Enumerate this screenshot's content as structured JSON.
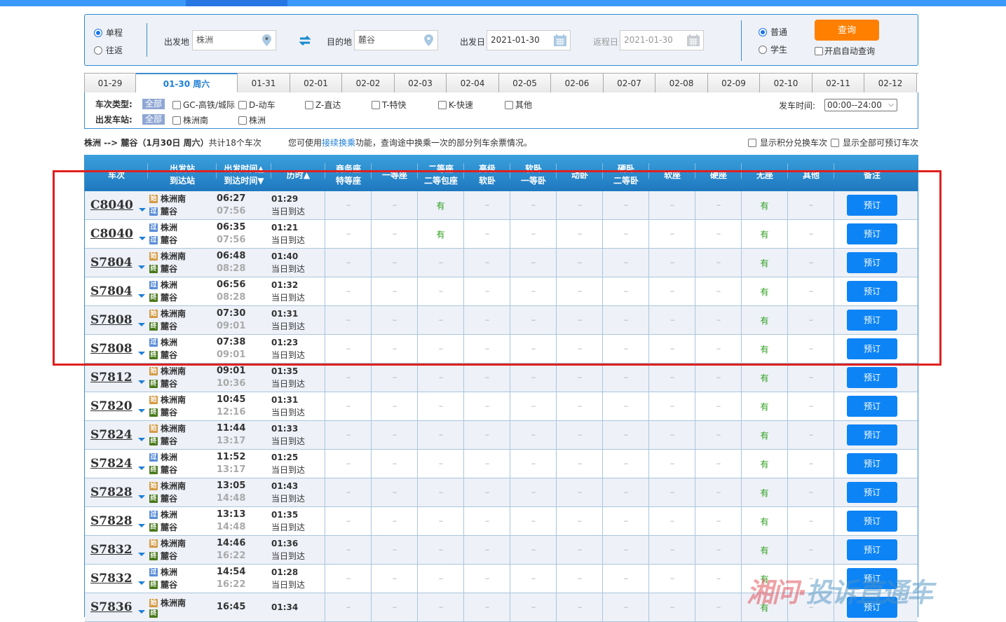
{
  "search": {
    "trip_types": [
      {
        "label": "单程",
        "selected": true
      },
      {
        "label": "往返",
        "selected": false
      }
    ],
    "from_label": "出发地",
    "from_value": "株洲",
    "to_label": "目的地",
    "to_value": "麓谷",
    "depart_label": "出发日",
    "depart_value": "2021-01-30",
    "return_label": "返程日",
    "return_value": "2021-01-30",
    "passenger_types": [
      {
        "label": "普通",
        "selected": true
      },
      {
        "label": "学生",
        "selected": false
      }
    ],
    "query_label": "查询",
    "auto_query_label": "开启自动查询"
  },
  "date_tabs": [
    {
      "label": "01-29",
      "active": false
    },
    {
      "label": "01-30 周六",
      "active": true
    },
    {
      "label": "01-31",
      "active": false
    },
    {
      "label": "02-01",
      "active": false
    },
    {
      "label": "02-02",
      "active": false
    },
    {
      "label": "02-03",
      "active": false
    },
    {
      "label": "02-04",
      "active": false
    },
    {
      "label": "02-05",
      "active": false
    },
    {
      "label": "02-06",
      "active": false
    },
    {
      "label": "02-07",
      "active": false
    },
    {
      "label": "02-08",
      "active": false
    },
    {
      "label": "02-09",
      "active": false
    },
    {
      "label": "02-10",
      "active": false
    },
    {
      "label": "02-11",
      "active": false
    },
    {
      "label": "02-12",
      "active": false
    }
  ],
  "filters": {
    "train_type_label": "车次类型:",
    "all_label": "全部",
    "train_types": [
      "GC-高铁/城际",
      "D-动车",
      "Z-直达",
      "T-特快",
      "K-快速",
      "其他"
    ],
    "station_label": "出发车站:",
    "stations": [
      "株洲南",
      "株洲"
    ],
    "depart_time_label": "发车时间:",
    "depart_time_value": "00:00--24:00"
  },
  "summary": {
    "route": "株洲 --> 麓谷（1月30日  周六）",
    "count": "共计18个车次",
    "hint_prefix": "您可使用",
    "hint_link": "接续换乘",
    "hint_suffix": "功能，查询途中换乘一次的部分列车余票情况。",
    "option_points": "显示积分兑换车次",
    "option_all": "显示全部可预订车次"
  },
  "table": {
    "headers": [
      [
        "车次"
      ],
      [
        "出发站",
        "到达站"
      ],
      [
        "出发时间▲",
        "到达时间▼"
      ],
      [
        "历时▲"
      ],
      [
        "商务座",
        "特等座"
      ],
      [
        "一等座"
      ],
      [
        "二等座",
        "二等包座"
      ],
      [
        "高级",
        "软卧"
      ],
      [
        "软卧",
        "一等卧"
      ],
      [
        "动卧"
      ],
      [
        "硬卧",
        "二等卧"
      ],
      [
        "软座"
      ],
      [
        "硬座"
      ],
      [
        "无座"
      ],
      [
        "其他"
      ],
      [
        "备注"
      ]
    ],
    "badge_labels": {
      "start": "始",
      "pass": "过",
      "end": "终"
    },
    "na": "--",
    "yes": "有",
    "book_label": "预订",
    "rows": [
      {
        "train": "C8040",
        "from": "株洲南",
        "from_type": "start",
        "to": "麓谷",
        "to_type": "pass",
        "dep": "06:27",
        "arr": "07:56",
        "duration": "01:29",
        "arrive_note": "当日到达",
        "seats": [
          "--",
          "--",
          "有",
          "--",
          "--",
          "--",
          "--",
          "--",
          "--",
          "有",
          "--"
        ]
      },
      {
        "train": "C8040",
        "from": "株洲",
        "from_type": "pass",
        "to": "麓谷",
        "to_type": "pass",
        "dep": "06:35",
        "arr": "07:56",
        "duration": "01:21",
        "arrive_note": "当日到达",
        "seats": [
          "--",
          "--",
          "有",
          "--",
          "--",
          "--",
          "--",
          "--",
          "--",
          "有",
          "--"
        ]
      },
      {
        "train": "S7804",
        "from": "株洲南",
        "from_type": "start",
        "to": "麓谷",
        "to_type": "end",
        "dep": "06:48",
        "arr": "08:28",
        "duration": "01:40",
        "arrive_note": "当日到达",
        "seats": [
          "--",
          "--",
          "--",
          "--",
          "--",
          "--",
          "--",
          "--",
          "--",
          "有",
          "--"
        ]
      },
      {
        "train": "S7804",
        "from": "株洲",
        "from_type": "pass",
        "to": "麓谷",
        "to_type": "end",
        "dep": "06:56",
        "arr": "08:28",
        "duration": "01:32",
        "arrive_note": "当日到达",
        "seats": [
          "--",
          "--",
          "--",
          "--",
          "--",
          "--",
          "--",
          "--",
          "--",
          "有",
          "--"
        ]
      },
      {
        "train": "S7808",
        "from": "株洲南",
        "from_type": "start",
        "to": "麓谷",
        "to_type": "end",
        "dep": "07:30",
        "arr": "09:01",
        "duration": "01:31",
        "arrive_note": "当日到达",
        "seats": [
          "--",
          "--",
          "--",
          "--",
          "--",
          "--",
          "--",
          "--",
          "--",
          "有",
          "--"
        ]
      },
      {
        "train": "S7808",
        "from": "株洲",
        "from_type": "pass",
        "to": "麓谷",
        "to_type": "end",
        "dep": "07:38",
        "arr": "09:01",
        "duration": "01:23",
        "arrive_note": "当日到达",
        "seats": [
          "--",
          "--",
          "--",
          "--",
          "--",
          "--",
          "--",
          "--",
          "--",
          "有",
          "--"
        ]
      },
      {
        "train": "S7812",
        "from": "株洲南",
        "from_type": "start",
        "to": "麓谷",
        "to_type": "end",
        "dep": "09:01",
        "arr": "10:36",
        "duration": "01:35",
        "arrive_note": "当日到达",
        "seats": [
          "--",
          "--",
          "--",
          "--",
          "--",
          "--",
          "--",
          "--",
          "--",
          "有",
          "--"
        ]
      },
      {
        "train": "S7820",
        "from": "株洲南",
        "from_type": "start",
        "to": "麓谷",
        "to_type": "end",
        "dep": "10:45",
        "arr": "12:16",
        "duration": "01:31",
        "arrive_note": "当日到达",
        "seats": [
          "--",
          "--",
          "--",
          "--",
          "--",
          "--",
          "--",
          "--",
          "--",
          "有",
          "--"
        ]
      },
      {
        "train": "S7824",
        "from": "株洲南",
        "from_type": "start",
        "to": "麓谷",
        "to_type": "end",
        "dep": "11:44",
        "arr": "13:17",
        "duration": "01:33",
        "arrive_note": "当日到达",
        "seats": [
          "--",
          "--",
          "--",
          "--",
          "--",
          "--",
          "--",
          "--",
          "--",
          "有",
          "--"
        ]
      },
      {
        "train": "S7824",
        "from": "株洲",
        "from_type": "pass",
        "to": "麓谷",
        "to_type": "end",
        "dep": "11:52",
        "arr": "13:17",
        "duration": "01:25",
        "arrive_note": "当日到达",
        "seats": [
          "--",
          "--",
          "--",
          "--",
          "--",
          "--",
          "--",
          "--",
          "--",
          "有",
          "--"
        ]
      },
      {
        "train": "S7828",
        "from": "株洲南",
        "from_type": "start",
        "to": "麓谷",
        "to_type": "end",
        "dep": "13:05",
        "arr": "14:48",
        "duration": "01:43",
        "arrive_note": "当日到达",
        "seats": [
          "--",
          "--",
          "--",
          "--",
          "--",
          "--",
          "--",
          "--",
          "--",
          "有",
          "--"
        ]
      },
      {
        "train": "S7828",
        "from": "株洲",
        "from_type": "pass",
        "to": "麓谷",
        "to_type": "end",
        "dep": "13:13",
        "arr": "14:48",
        "duration": "01:35",
        "arrive_note": "当日到达",
        "seats": [
          "--",
          "--",
          "--",
          "--",
          "--",
          "--",
          "--",
          "--",
          "--",
          "有",
          "--"
        ]
      },
      {
        "train": "S7832",
        "from": "株洲南",
        "from_type": "start",
        "to": "麓谷",
        "to_type": "end",
        "dep": "14:46",
        "arr": "16:22",
        "duration": "01:36",
        "arrive_note": "当日到达",
        "seats": [
          "--",
          "--",
          "--",
          "--",
          "--",
          "--",
          "--",
          "--",
          "--",
          "有",
          "--"
        ]
      },
      {
        "train": "S7832",
        "from": "株洲",
        "from_type": "pass",
        "to": "麓谷",
        "to_type": "end",
        "dep": "14:54",
        "arr": "16:22",
        "duration": "01:28",
        "arrive_note": "当日到达",
        "seats": [
          "--",
          "--",
          "--",
          "--",
          "--",
          "--",
          "--",
          "--",
          "--",
          "有",
          "--"
        ]
      },
      {
        "train": "S7836",
        "from": "株洲南",
        "from_type": "start",
        "to": "",
        "to_type": "end",
        "dep": "16:45",
        "arr": "",
        "duration": "01:34",
        "arrive_note": "",
        "seats": [
          "--",
          "--",
          "--",
          "--",
          "--",
          "--",
          "--",
          "--",
          "--",
          "有",
          "--"
        ]
      }
    ]
  },
  "watermark": {
    "part1": "湘问·",
    "part2": "投诉直通车"
  }
}
